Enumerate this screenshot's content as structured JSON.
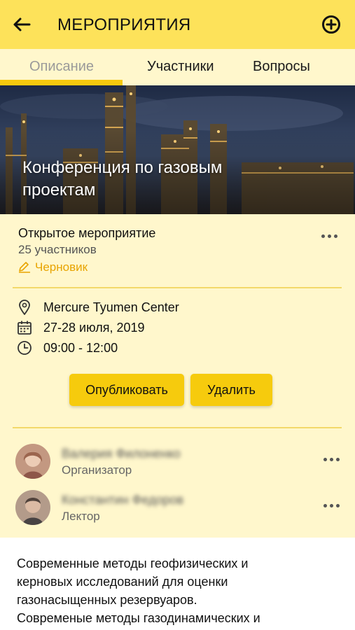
{
  "header": {
    "title": "МЕРОПРИЯТИЯ",
    "back_icon": "arrow-left-icon",
    "add_icon": "plus-circle-icon"
  },
  "tabs": [
    {
      "label": "Описание",
      "active": true
    },
    {
      "label": "Участники",
      "active": false
    },
    {
      "label": "Вопросы",
      "active": false
    }
  ],
  "event": {
    "title": "Конференция по газовым проектам",
    "type": "Открытое мероприятие",
    "participants": "25 участников",
    "status": "Черновик",
    "location": "Mercure Tyumen Center",
    "date": "27-28 июля, 2019",
    "time": "09:00 - 12:00"
  },
  "actions": {
    "publish": "Опубликовать",
    "delete": "Удалить"
  },
  "people": [
    {
      "name": "Валерия Филоненко",
      "role": "Организатор"
    },
    {
      "name": "Константин Федоров",
      "role": "Лектор"
    }
  ],
  "description": {
    "line1": "Современные методы геофизических и",
    "line2": "керновых исследований для оценки",
    "line3": "газонасыщенных резервуаров.",
    "line4": "Современые методы газодинамических и"
  },
  "colors": {
    "header_bg": "#fde25a",
    "card_bg": "#fff7cc",
    "accent": "#f6c90e",
    "draft": "#e8a400"
  }
}
